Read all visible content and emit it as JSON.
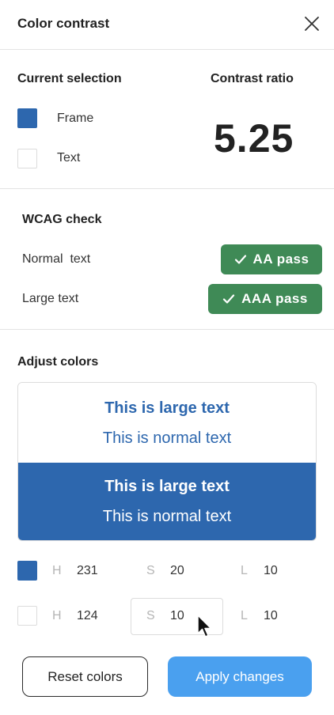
{
  "header": {
    "title": "Color contrast",
    "close_icon": "close-icon"
  },
  "selection": {
    "label": "Current selection",
    "items": [
      {
        "label": "Frame",
        "color": "#2d67ae"
      },
      {
        "label": "Text",
        "color": "#ffffff"
      }
    ]
  },
  "contrast": {
    "label": "Contrast ratio",
    "value": "5.25"
  },
  "wcag": {
    "label": "WCAG check",
    "rows": [
      {
        "label": "Normal  text",
        "badge": "AA pass"
      },
      {
        "label": "Large text",
        "badge": "AAA pass"
      }
    ],
    "badge_color": "#3f8a56"
  },
  "adjust": {
    "label": "Adjust colors",
    "preview": {
      "large": "This is large text",
      "normal": "This is normal text"
    },
    "rows": [
      {
        "color": "#2d67ae",
        "h_label": "H",
        "h": "231",
        "s_label": "S",
        "s": "20",
        "l_label": "L",
        "l": "10"
      },
      {
        "color": "#ffffff",
        "h_label": "H",
        "h": "124",
        "s_label": "S",
        "s": "10",
        "l_label": "L",
        "l": "10"
      }
    ]
  },
  "buttons": {
    "reset": "Reset colors",
    "apply": "Apply changes"
  },
  "colors": {
    "accent": "#2d67ae",
    "apply_button": "#4aa0ef",
    "pass": "#3f8a56"
  }
}
